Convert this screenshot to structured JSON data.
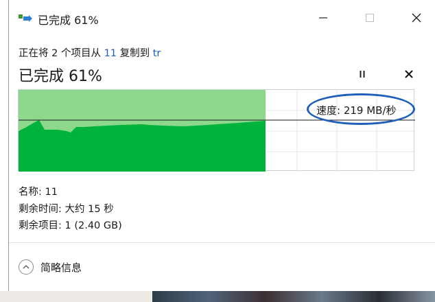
{
  "window": {
    "title": "已完成 61%",
    "controls": {
      "minimize": "minimize",
      "maximize": "maximize",
      "close": "close"
    }
  },
  "copy": {
    "prefix": "正在将 2 个项目从 ",
    "source": "11",
    "middle": " 复制到 ",
    "destination": "tr"
  },
  "progress": {
    "heading": "已完成 61%",
    "percent": 61,
    "speed_text": "速度: 219 MB/秒",
    "colors": {
      "fill": "#00b33c",
      "fill_light": "#8ed88e",
      "border": "#cfcfcf",
      "line": "#1a1a1a",
      "annotation": "#1f5fb8"
    }
  },
  "details": {
    "name": "名称: 11",
    "time_remaining": "剩余时间: 大约 15 秒",
    "items_remaining": "剩余项目: 1 (2.40 GB)"
  },
  "footer": {
    "more_info_label": "简略信息"
  }
}
